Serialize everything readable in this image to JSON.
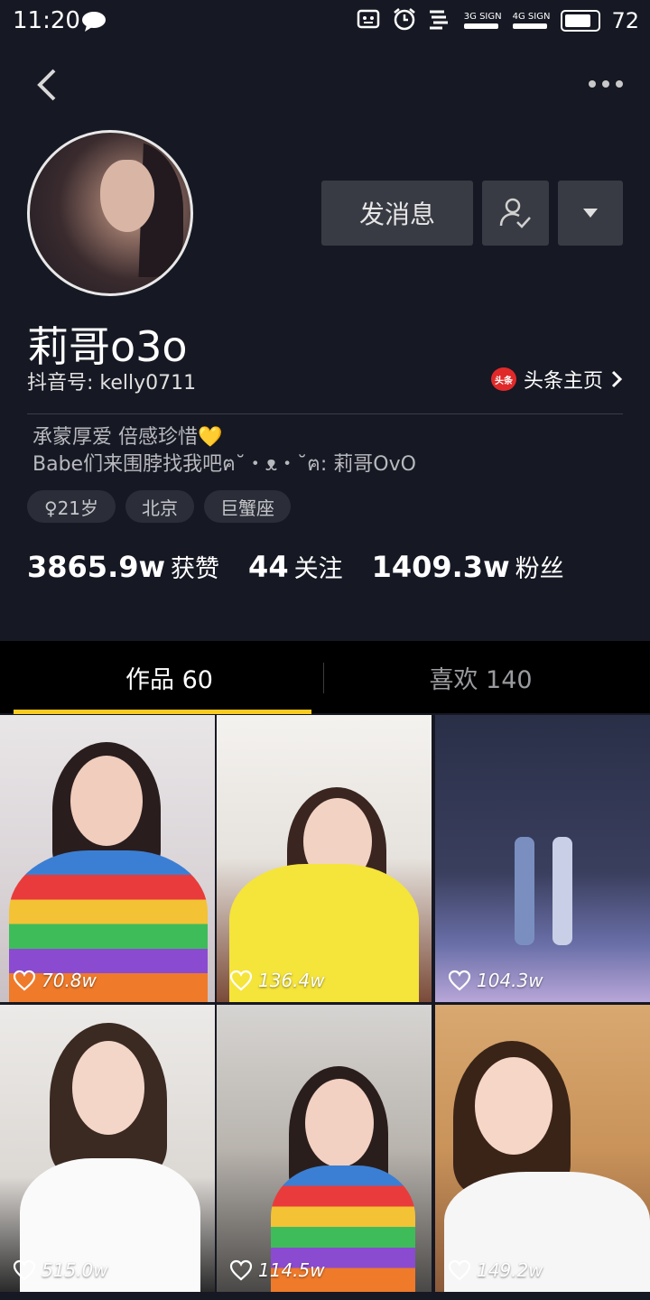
{
  "status_bar": {
    "time": "11:20",
    "signal_1": "3G SIGN",
    "signal_2": "4G SIGN",
    "battery": "72"
  },
  "profile": {
    "nickname": "莉哥o3o",
    "douyin_id": "抖音号: kelly0711",
    "toutiao_badge": "头条",
    "toutiao_link": "头条主页",
    "message_button": "发消息",
    "bio_line1": "承蒙厚爱  倍感珍惜💛",
    "bio_line2": "Babe们来围脖找我吧ฅ˘・ᴥ・˘ฅ: 莉哥OvO",
    "tags": {
      "age": "♀21岁",
      "city": "北京",
      "zodiac": "巨蟹座"
    },
    "stats": {
      "likes_num": "3865.9w",
      "likes_label": "获赞",
      "following_num": "44",
      "following_label": "关注",
      "fans_num": "1409.3w",
      "fans_label": "粉丝"
    }
  },
  "tabs": {
    "works": "作品 60",
    "likes": "喜欢 140"
  },
  "videos": [
    {
      "likes": "70.8w"
    },
    {
      "likes": "136.4w"
    },
    {
      "likes": "104.3w"
    },
    {
      "likes": "515.0w"
    },
    {
      "likes": "114.5w"
    },
    {
      "likes": "149.2w"
    }
  ],
  "colors": {
    "background": "#161823",
    "accent": "#facc21",
    "button": "#393b44"
  }
}
